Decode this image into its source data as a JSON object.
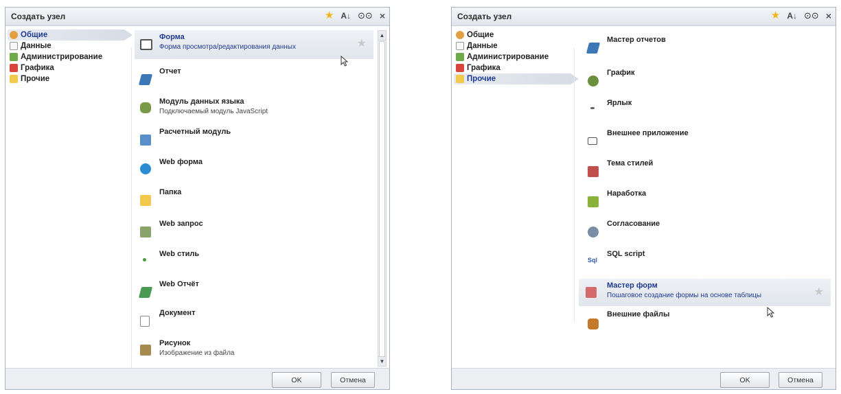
{
  "left_dialog": {
    "title": "Создать узел",
    "categories": [
      {
        "label": "Общие",
        "icon": "globe-icon",
        "active": true
      },
      {
        "label": "Данные",
        "icon": "table-icon",
        "active": false
      },
      {
        "label": "Администрирование",
        "icon": "admin-icon",
        "active": false
      },
      {
        "label": "Графика",
        "icon": "graphics-icon",
        "active": false
      },
      {
        "label": "Прочие",
        "icon": "folder-icon",
        "active": false
      }
    ],
    "items": [
      {
        "name": "Форма",
        "desc": "Форма просмотра/редактирования данных",
        "icon": "form-window-icon"
      },
      {
        "name": "Отчет",
        "desc": "",
        "icon": "report-icon"
      },
      {
        "name": "Модуль данных языка",
        "desc": "Подключаемый модуль JavaScript",
        "icon": "data-module-icon"
      },
      {
        "name": "Расчетный модуль",
        "desc": "",
        "icon": "calc-module-icon"
      },
      {
        "name": "Web форма",
        "desc": "",
        "icon": "web-form-icon"
      },
      {
        "name": "Папка",
        "desc": "",
        "icon": "folder-icon"
      },
      {
        "name": "Web запрос",
        "desc": "",
        "icon": "web-request-icon"
      },
      {
        "name": "Web стиль",
        "desc": "",
        "icon": "web-style-icon"
      },
      {
        "name": "Web Отчёт",
        "desc": "",
        "icon": "web-report-icon"
      },
      {
        "name": "Документ",
        "desc": "",
        "icon": "document-icon"
      },
      {
        "name": "Рисунок",
        "desc": "Изображение из файла",
        "icon": "picture-icon"
      }
    ],
    "ok_label": "OK",
    "cancel_label": "Отмена"
  },
  "right_dialog": {
    "title": "Создать узел",
    "categories": [
      {
        "label": "Общие",
        "icon": "globe-icon",
        "active": false
      },
      {
        "label": "Данные",
        "icon": "table-icon",
        "active": false
      },
      {
        "label": "Администрирование",
        "icon": "admin-icon",
        "active": false
      },
      {
        "label": "Графика",
        "icon": "graphics-icon",
        "active": false
      },
      {
        "label": "Прочие",
        "icon": "folder-icon",
        "active": true
      }
    ],
    "items": [
      {
        "name": "Мастер отчетов",
        "desc": "",
        "icon": "report-wizard-icon"
      },
      {
        "name": "График",
        "desc": "",
        "icon": "chart-icon"
      },
      {
        "name": "Ярлык",
        "desc": "",
        "icon": "shortcut-icon"
      },
      {
        "name": "Внешнее приложение",
        "desc": "",
        "icon": "external-app-icon"
      },
      {
        "name": "Тема стилей",
        "desc": "",
        "icon": "style-theme-icon"
      },
      {
        "name": "Наработка",
        "desc": "",
        "icon": "work-icon"
      },
      {
        "name": "Согласование",
        "desc": "",
        "icon": "approval-icon"
      },
      {
        "name": "SQL script",
        "desc": "",
        "icon": "sql-icon"
      },
      {
        "name": "Мастер форм",
        "desc": "Пошаговое создание формы на основе таблицы",
        "icon": "form-wizard-icon"
      },
      {
        "name": "Внешние файлы",
        "desc": "",
        "icon": "external-files-icon"
      }
    ],
    "ok_label": "OK",
    "cancel_label": "Отмена"
  }
}
